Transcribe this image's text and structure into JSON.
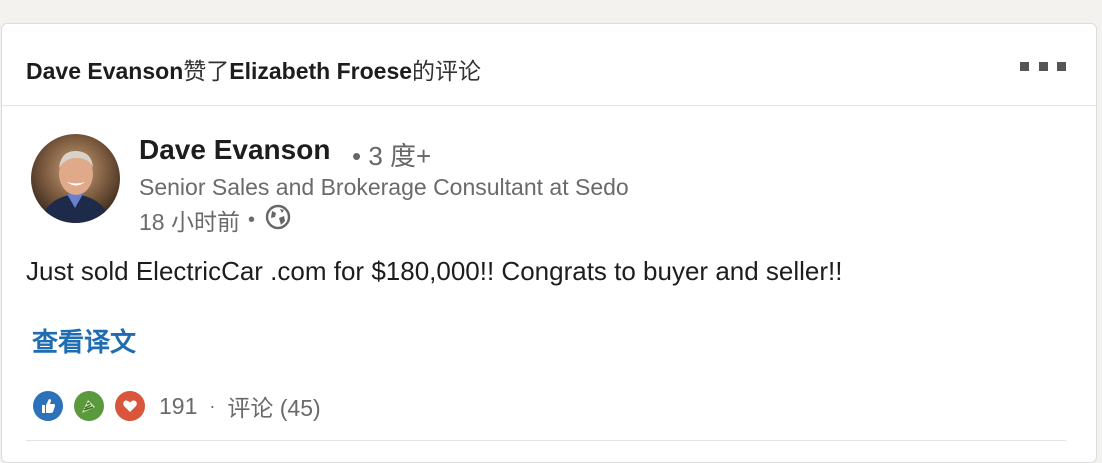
{
  "header": {
    "actor_name": "Dave Evanson",
    "action_text": "赞了",
    "target_name": "Elizabeth Froese",
    "target_suffix": "的评论"
  },
  "post": {
    "author_name": "Dave Evanson",
    "connection_degree": "• 3 度+",
    "author_headline": "Senior Sales and Brokerage Consultant at Sedo",
    "posted_time": "18 小时前",
    "time_separator": "•",
    "visibility_icon": "globe-icon",
    "body_text": "Just sold ElectricCar .com for $180,000!!  Congrats to buyer and seller!!",
    "translate_label": "查看译文"
  },
  "social": {
    "reaction_icons": [
      "like-icon",
      "celebrate-icon",
      "love-icon"
    ],
    "reaction_count": "191",
    "separator": "·",
    "comments_label": "评论 (45)"
  },
  "colors": {
    "link_blue": "#1f6db0",
    "like_blue": "#2b72b8",
    "celebrate_green": "#5a9a3c",
    "love_red": "#d9553b"
  }
}
